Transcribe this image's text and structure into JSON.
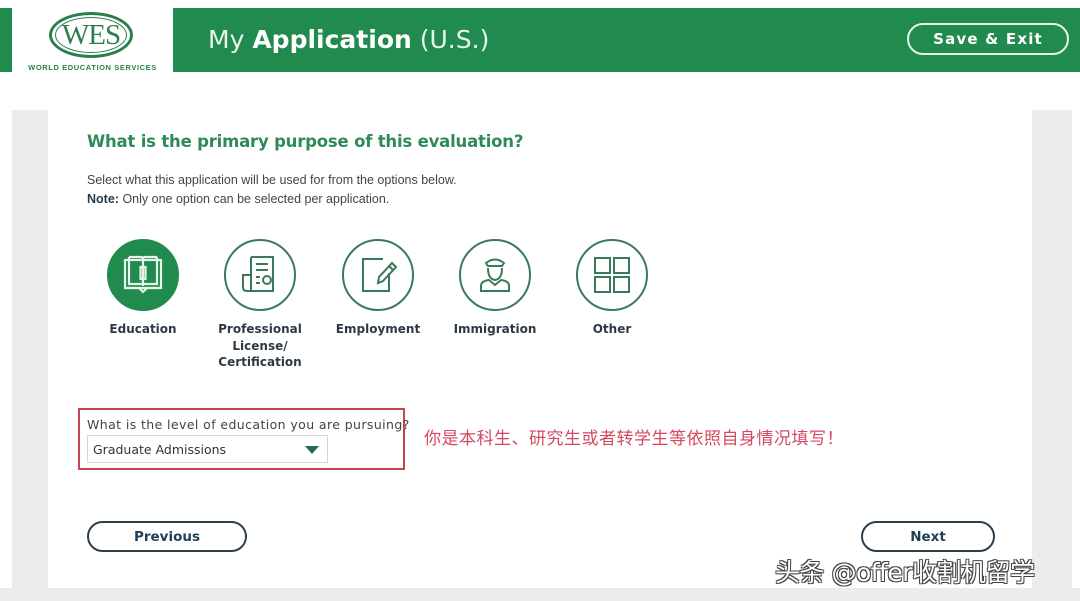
{
  "header": {
    "logo_text": "WES",
    "logo_subtitle": "WORLD EDUCATION SERVICES",
    "title_prefix": "My",
    "title_bold": "Application",
    "title_suffix": "(U.S.)",
    "save_exit_label": "Save & Exit",
    "brand_color": "#218a4f"
  },
  "main": {
    "question": "What is the primary purpose of this evaluation?",
    "description": "Select what this application will be used for from the options below.",
    "note_label": "Note:",
    "note_text": "Only one option can be selected per application.",
    "options": [
      {
        "label": "Education",
        "icon": "open-book-icon",
        "selected": true
      },
      {
        "label": "Professional License/ Certification",
        "icon": "certificate-document-icon",
        "selected": false
      },
      {
        "label": "Employment",
        "icon": "edit-note-icon",
        "selected": false
      },
      {
        "label": "Immigration",
        "icon": "officer-icon",
        "selected": false
      },
      {
        "label": "Other",
        "icon": "grid-icon",
        "selected": false
      }
    ],
    "option_label_lines": {
      "professional": [
        "Professional",
        "License/",
        "Certification"
      ]
    },
    "education_level": {
      "label": "What is the level of education you are pursuing?",
      "value": "Graduate Admissions"
    },
    "annotation": "你是本科生、研究生或者转学生等依照自身情况填写！",
    "annotation_color": "#d4495e"
  },
  "footer": {
    "previous_label": "Previous",
    "next_label": "Next"
  },
  "watermark": "头条 @offer收割机留学"
}
